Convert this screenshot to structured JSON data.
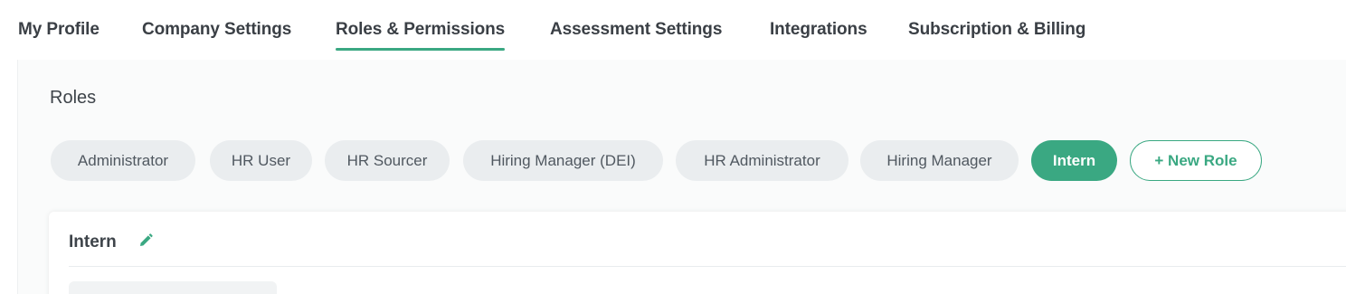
{
  "colors": {
    "accent": "#3aa882",
    "chip_bg": "#eaedef",
    "panel_bg": "#fafbfb"
  },
  "tabs": [
    {
      "label": "My Profile",
      "active": false
    },
    {
      "label": "Company Settings",
      "active": false
    },
    {
      "label": "Roles & Permissions",
      "active": true
    },
    {
      "label": "Assessment Settings",
      "active": false
    },
    {
      "label": "Integrations",
      "active": false
    },
    {
      "label": "Subscription & Billing",
      "active": false
    }
  ],
  "roles_section": {
    "title": "Roles",
    "roles": [
      {
        "label": "Administrator",
        "selected": false
      },
      {
        "label": "HR User",
        "selected": false
      },
      {
        "label": "HR Sourcer",
        "selected": false
      },
      {
        "label": "Hiring Manager (DEI)",
        "selected": false
      },
      {
        "label": "HR Administrator",
        "selected": false
      },
      {
        "label": "Hiring Manager",
        "selected": false
      },
      {
        "label": "Intern",
        "selected": true
      }
    ],
    "new_role_label": "+ New Role"
  },
  "role_card": {
    "title": "Intern",
    "edit_icon": "pencil-icon"
  }
}
